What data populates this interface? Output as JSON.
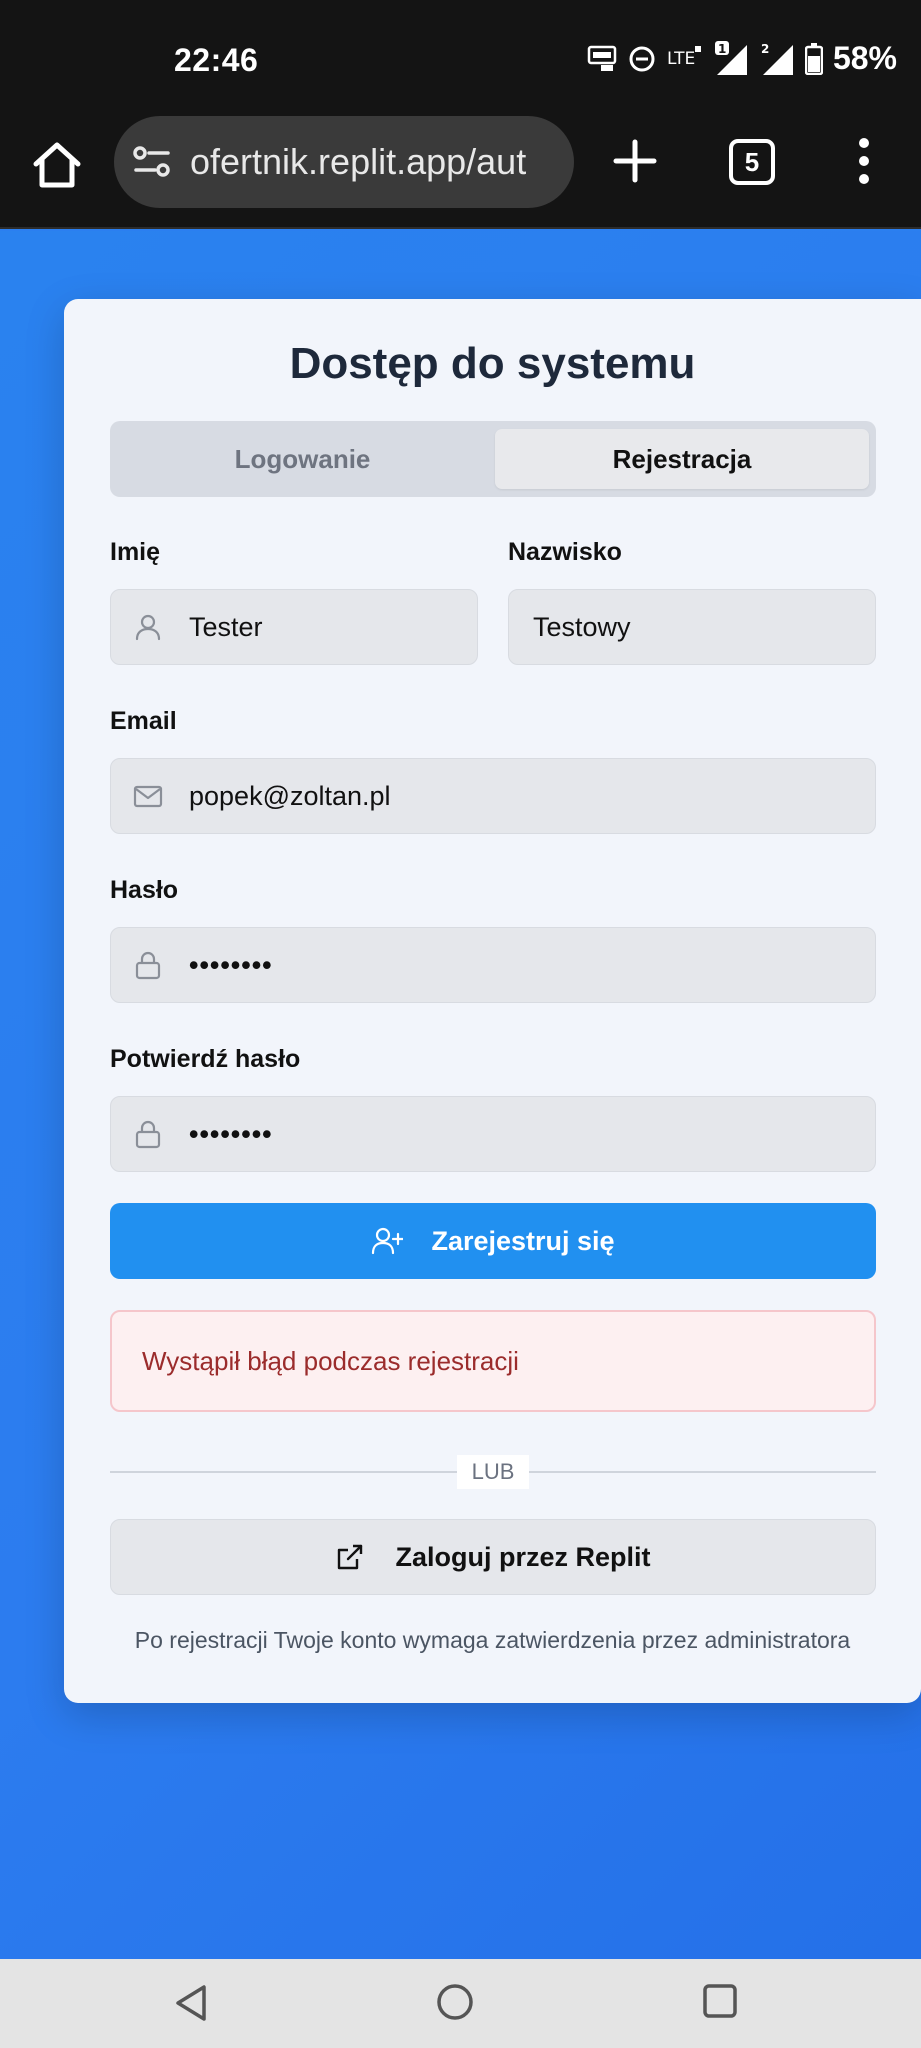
{
  "status_bar": {
    "time": "22:46",
    "battery_percent": "58%",
    "icons": [
      "auto-hz-icon",
      "dnd-icon",
      "lte-icon",
      "signal-1-icon",
      "signal-2-icon",
      "battery-icon"
    ]
  },
  "browser": {
    "url": "ofertnik.replit.app/aut",
    "tab_count": "5",
    "icons": [
      "home-icon",
      "site-settings-icon",
      "new-tab-icon",
      "tabs-icon",
      "more-menu-icon"
    ]
  },
  "card": {
    "title": "Dostęp do systemu",
    "tabs": [
      {
        "label": "Logowanie",
        "active": false
      },
      {
        "label": "Rejestracja",
        "active": true
      }
    ],
    "fields": {
      "first_name": {
        "label": "Imię",
        "value": "Tester",
        "icon": "user-icon"
      },
      "last_name": {
        "label": "Nazwisko",
        "value": "Testowy"
      },
      "email": {
        "label": "Email",
        "value": "popek@zoltan.pl",
        "icon": "mail-icon"
      },
      "password": {
        "label": "Hasło",
        "value": "••••••••",
        "icon": "lock-icon"
      },
      "confirm_password": {
        "label": "Potwierdź hasło",
        "value": "••••••••",
        "icon": "lock-icon"
      }
    },
    "register_button": {
      "label": "Zarejestruj się",
      "icon": "user-plus-icon"
    },
    "error_message": "Wystąpił błąd podczas rejestracji",
    "divider_label": "LUB",
    "replit_button": {
      "label": "Zaloguj przez Replit",
      "icon": "external-link-icon"
    },
    "footer_note": "Po rejestracji Twoje konto wymaga zatwierdzenia przez administratora"
  },
  "colors": {
    "page_background": "#2b7ff0",
    "primary_button": "#2190f0",
    "error_text": "#9b2c2c",
    "error_background": "#fdf0f1"
  }
}
